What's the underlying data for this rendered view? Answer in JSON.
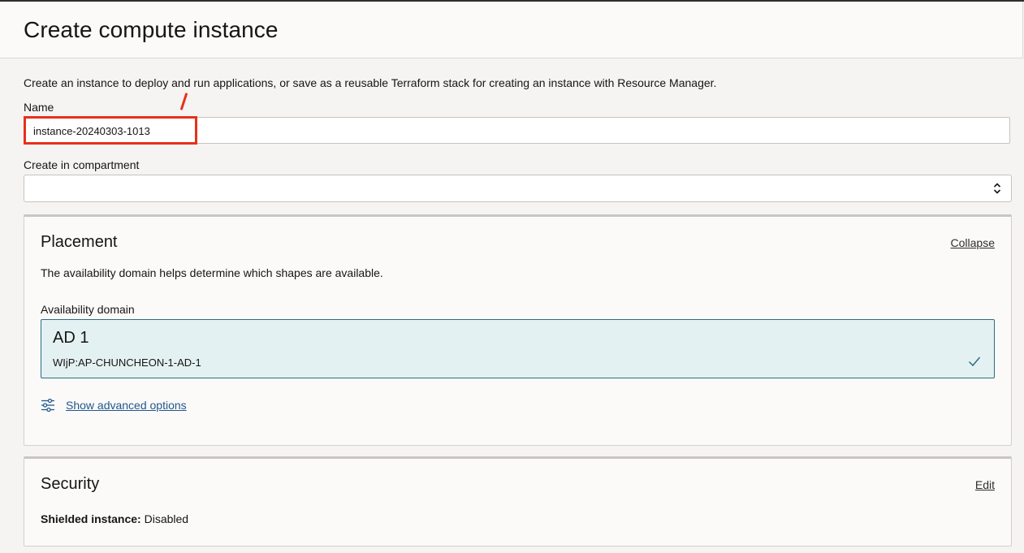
{
  "header": {
    "title": "Create compute instance"
  },
  "form": {
    "intro": "Create an instance to deploy and run applications, or save as a reusable Terraform stack for creating an instance with Resource Manager.",
    "name_label": "Name",
    "name_value": "instance-20240303-1013",
    "compartment_label": "Create in compartment",
    "compartment_value": ""
  },
  "placement": {
    "title": "Placement",
    "collapse_label": "Collapse",
    "description": "The availability domain helps determine which shapes are available.",
    "ad_label": "Availability domain",
    "ad_option": {
      "name": "AD 1",
      "id": "WIjP:AP-CHUNCHEON-1-AD-1",
      "selected": true
    },
    "advanced_label": "Show advanced options"
  },
  "security": {
    "title": "Security",
    "edit_label": "Edit",
    "shielded_label": "Shielded instance:",
    "shielded_value": "Disabled"
  },
  "colors": {
    "highlight": "#e8301b",
    "selected_tile_bg": "#e4f1f2",
    "selected_tile_border": "#2c6e7e",
    "link": "#22588c"
  },
  "icons": {
    "select": "chevron-up-down-icon",
    "selected": "checkmark-icon",
    "advanced": "sliders-icon"
  }
}
